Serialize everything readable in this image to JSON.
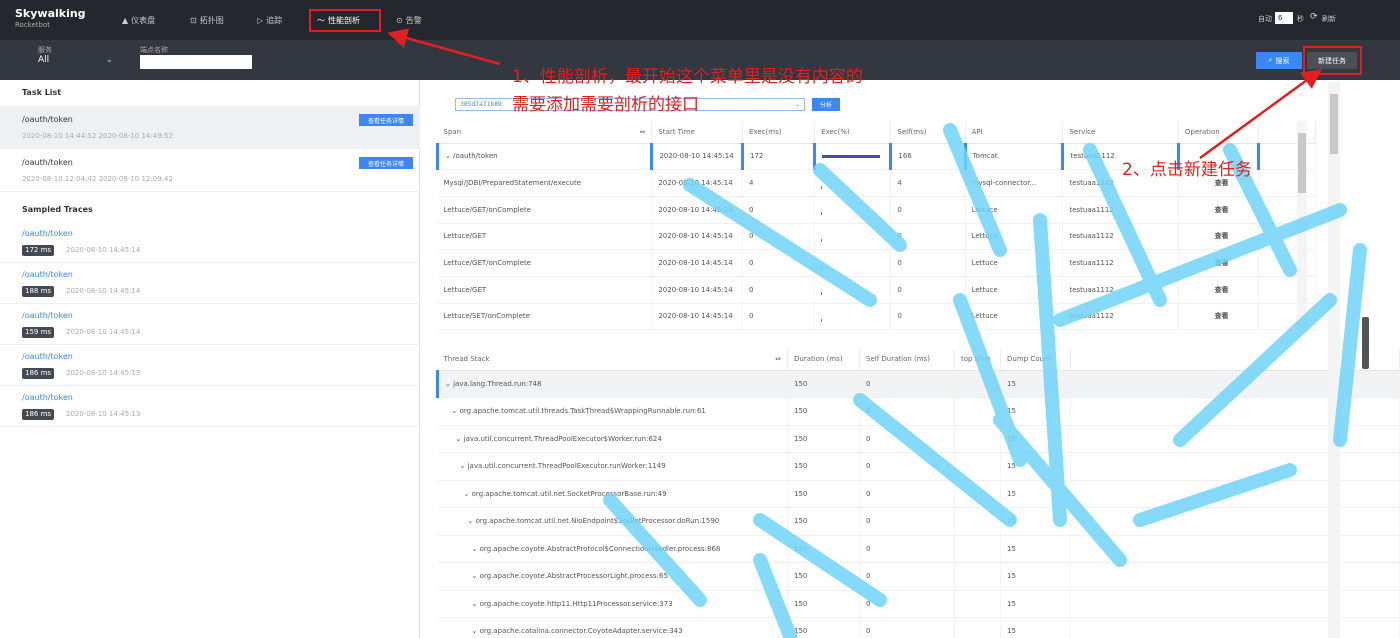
{
  "app": {
    "logo_title": "Skywalking",
    "logo_subtitle": "Rocketbot"
  },
  "nav": [
    {
      "icon": "▲",
      "label": "仪表盘"
    },
    {
      "icon": "⊡",
      "label": "拓扑图"
    },
    {
      "icon": "▷",
      "label": "追踪"
    },
    {
      "icon": "〜",
      "label": "性能剖析"
    },
    {
      "icon": "⊙",
      "label": "告警"
    }
  ],
  "header_right": {
    "auto_label": "自动",
    "interval_value": "6",
    "seconds_label": "秒",
    "refresh_label": "刷新"
  },
  "filter": {
    "service_label": "服务",
    "service_value": "All",
    "endpoint_label": "端点名称",
    "search_button": "搜索",
    "new_task_button": "新建任务"
  },
  "left": {
    "task_list_title": "Task List",
    "view_task_button": "查看任务详情",
    "tasks": [
      {
        "name": "/oauth/token",
        "time": "2020-08-10 14:44:52  2020-08-10 14:49:52"
      },
      {
        "name": "/oauth/token",
        "time": "2020-08-10 12:04:42  2020-08-10 12:09:42"
      }
    ],
    "sampled_traces_title": "Sampled Traces",
    "traces": [
      {
        "name": "/oauth/token",
        "duration": "172 ms",
        "time": "2020-08-10 14:45:14"
      },
      {
        "name": "/oauth/token",
        "duration": "188 ms",
        "time": "2020-08-10 14:45:14"
      },
      {
        "name": "/oauth/token",
        "duration": "159 ms",
        "time": "2020-08-10 14:45:14"
      },
      {
        "name": "/oauth/token",
        "duration": "186 ms",
        "time": "2020-08-10 14:45:13"
      },
      {
        "name": "/oauth/token",
        "duration": "186 ms",
        "time": "2020-08-10 14:45:13"
      }
    ]
  },
  "analysis": {
    "trace_select_value": "385d7a71b89",
    "analyze_button": "分析"
  },
  "span_table": {
    "columns": [
      "Span",
      "Start Time",
      "Exec(ms)",
      "Exec(%)",
      "Self(ms)",
      "API",
      "Service",
      "Operation"
    ],
    "view_label": "查看",
    "rows": [
      {
        "span": "/oauth/token",
        "start": "2020-08-10 14:45:14",
        "exec": "172",
        "self": "166",
        "api": "Tomcat",
        "service": "testuaa1112",
        "bar": 1.0
      },
      {
        "span": "Mysql/JDBI/PreparedStatement/execute",
        "start": "2020-08-10 14:45:14",
        "exec": "4",
        "self": "4",
        "api": "mysql-connector...",
        "service": "testuaa1112",
        "bar": 0.02
      },
      {
        "span": "Lettuce/GET/onComplete",
        "start": "2020-08-10 14:45:14",
        "exec": "0",
        "self": "0",
        "api": "Lettuce",
        "service": "testuaa1112",
        "bar": 0.0
      },
      {
        "span": "Lettuce/GET",
        "start": "2020-08-10 14:45:14",
        "exec": "0",
        "self": "0",
        "api": "Lettuce",
        "service": "testuaa1112",
        "bar": 0.0
      },
      {
        "span": "Lettuce/GET/onComplete",
        "start": "2020-08-10 14:45:14",
        "exec": "0",
        "self": "0",
        "api": "Lettuce",
        "service": "testuaa1112",
        "bar": 0.0
      },
      {
        "span": "Lettuce/GET",
        "start": "2020-08-10 14:45:14",
        "exec": "0",
        "self": "0",
        "api": "Lettuce",
        "service": "testuaa1112",
        "bar": 0.0
      },
      {
        "span": "Lettuce/SET/onComplete",
        "start": "2020-08-10 14:45:14",
        "exec": "0",
        "self": "0",
        "api": "Lettuce",
        "service": "testuaa1112",
        "bar": 0.0
      }
    ]
  },
  "thread_table": {
    "columns": [
      "Thread Stack",
      "Duration (ms)",
      "Self Duration (ms)",
      "top slow",
      "Dump Count"
    ],
    "rows": [
      {
        "stack": "java.lang.Thread.run:748",
        "duration": "150",
        "self": "0",
        "dump": "15"
      },
      {
        "stack": "org.apache.tomcat.util.threads.TaskThread$WrappingRunnable.run:61",
        "duration": "150",
        "self": "0",
        "dump": "15"
      },
      {
        "stack": "java.util.concurrent.ThreadPoolExecutor$Worker.run:624",
        "duration": "150",
        "self": "0",
        "dump": "15"
      },
      {
        "stack": "java.util.concurrent.ThreadPoolExecutor.runWorker:1149",
        "duration": "150",
        "self": "0",
        "dump": "15"
      },
      {
        "stack": "org.apache.tomcat.util.net.SocketProcessorBase.run:49",
        "duration": "150",
        "self": "0",
        "dump": "15"
      },
      {
        "stack": "org.apache.tomcat.util.net.NioEndpoint$SocketProcessor.doRun:1590",
        "duration": "150",
        "self": "0",
        "dump": "15"
      },
      {
        "stack": "org.apache.coyote.AbstractProtocol$ConnectionHandler.process:868",
        "duration": "150",
        "self": "0",
        "dump": "15"
      },
      {
        "stack": "org.apache.coyote.AbstractProcessorLight.process:65",
        "duration": "150",
        "self": "0",
        "dump": "15"
      },
      {
        "stack": "org.apache.coyote.http11.Http11Processor.service:373",
        "duration": "150",
        "self": "0",
        "dump": "15"
      },
      {
        "stack": "org.apache.catalina.connector.CoyoteAdapter.service:343",
        "duration": "150",
        "self": "0",
        "dump": "15"
      }
    ]
  },
  "annotations": {
    "step1_line1": "1、性能剖析，最开始这个菜单里是没有内容的",
    "step1_line2": "需要添加需要剖析的接口",
    "step2": "2、点击新建任务"
  },
  "colors": {
    "accent": "#3d87f5",
    "annotation_red": "#e02020",
    "watermark": "#6fd4f7",
    "nav_bg": "#24272d"
  }
}
